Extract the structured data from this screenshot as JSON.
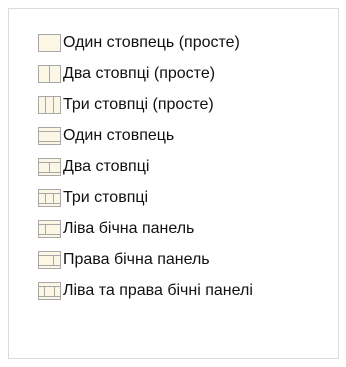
{
  "layout_menu": {
    "items": [
      {
        "label": "Один стовпець (просте)",
        "icon": "layout-one-column-simple-icon"
      },
      {
        "label": "Два стовпці (просте)",
        "icon": "layout-two-columns-simple-icon"
      },
      {
        "label": "Три стовпці (просте)",
        "icon": "layout-three-columns-simple-icon"
      },
      {
        "label": "Один стовпець",
        "icon": "layout-one-column-icon"
      },
      {
        "label": "Два стовпці",
        "icon": "layout-two-columns-icon"
      },
      {
        "label": "Три стовпці",
        "icon": "layout-three-columns-icon"
      },
      {
        "label": "Ліва бічна панель",
        "icon": "layout-left-sidebar-icon"
      },
      {
        "label": "Права бічна панель",
        "icon": "layout-right-sidebar-icon"
      },
      {
        "label": "Ліва та права бічні панелі",
        "icon": "layout-both-sidebars-icon"
      }
    ]
  },
  "colors": {
    "icon_fill": "#fbf7e4",
    "icon_stroke": "#a7a7a7",
    "text": "#111111"
  }
}
